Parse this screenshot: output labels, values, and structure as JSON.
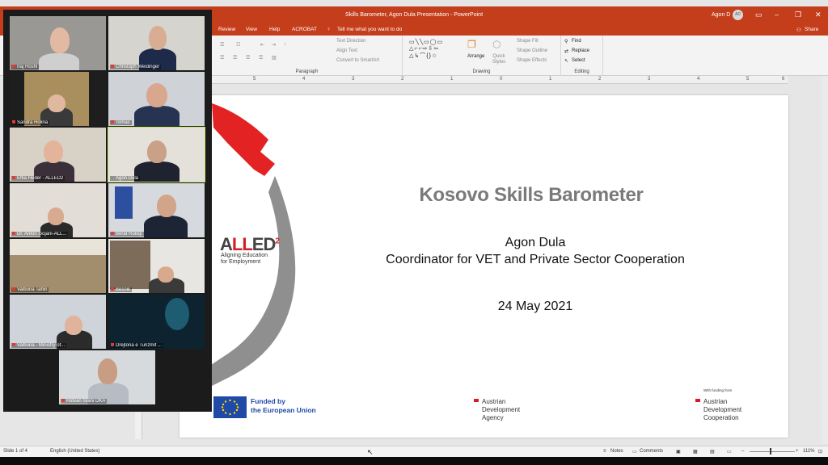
{
  "app": {
    "window_title": "Skills Barometer, Agon Dula Presentation  -  PowerPoint",
    "user": "Agon D",
    "user_initials": "AD",
    "menu_tabs": [
      "Review",
      "View",
      "Help",
      "ACROBAT"
    ],
    "tell_me": "Tell me what you want to do",
    "share": "Share"
  },
  "ribbon": {
    "paragraph_items": [
      "Text Direction",
      "Align Text",
      "Convert to SmartArt"
    ],
    "paragraph_label": "Paragraph",
    "arrange": "Arrange",
    "quick_styles": "Quick Styles",
    "shape_items": [
      "Shape Fill",
      "Shape Outline",
      "Shape Effects"
    ],
    "drawing_label": "Drawing",
    "editing_items": [
      "Find",
      "Replace",
      "Select"
    ],
    "editing_label": "Editing"
  },
  "ruler": {
    "ticks": [
      "5",
      "4",
      "3",
      "2",
      "1",
      "0",
      "1",
      "2",
      "3",
      "4",
      "5",
      "6"
    ]
  },
  "slide": {
    "title": "Kosovo Skills Barometer",
    "presenter": "Agon Dula",
    "role": "Coordinator for VET and Private Sector Cooperation",
    "date": "24 May 2021",
    "logo_prefix": "A",
    "logo_highlight": "LL",
    "logo_suffix": "ED",
    "logo_sup": "2",
    "logo_sub_1": "Aligning Education",
    "logo_sub_2": "for Employment",
    "eu_line1": "Funded by",
    "eu_line2": "the European Union",
    "ada_1": [
      "Austrian",
      "Development",
      "Agency"
    ],
    "funding_note": "With funding from",
    "ada_2": [
      "Austrian",
      "Development",
      "Cooperation"
    ]
  },
  "status": {
    "slide_info": "Slide 1 of 4",
    "language": "English (United States)",
    "notes": "Notes",
    "comments": "Comments",
    "zoom": "111%"
  },
  "participants": [
    {
      "name": "Iraj Hoshi"
    },
    {
      "name": "Christoph Weidinger"
    },
    {
      "name": "Sandra Holina"
    },
    {
      "name": "Tomas"
    },
    {
      "name": "Efka Heder - ALLED2"
    },
    {
      "name": "Agon Dula"
    },
    {
      "name": "Dr. Anton Gojani-ALL..."
    },
    {
      "name": "Berat Rukiqi"
    },
    {
      "name": "Valbona Tahiri"
    },
    {
      "name": "Besnik"
    },
    {
      "name": "Valbona - Ministry of..."
    },
    {
      "name": "Drejtoria e Turizmit ..."
    },
    {
      "name": "Ridvan Islani DKA"
    }
  ]
}
